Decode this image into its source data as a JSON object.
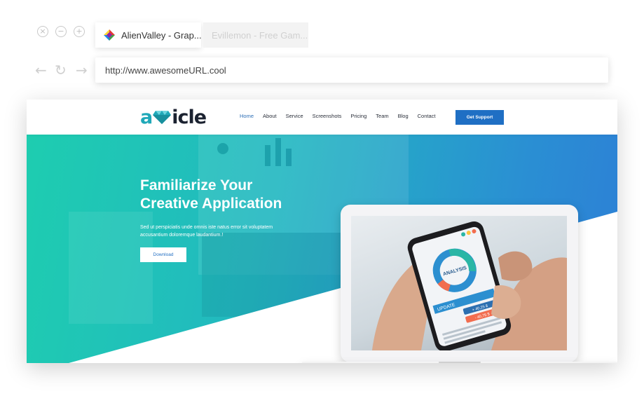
{
  "browser": {
    "tabs": [
      {
        "title": "AlienValley - Grap...",
        "active": true
      },
      {
        "title": "Evillemon - Free Gam...",
        "active": false
      }
    ],
    "url": "http://www.awesomeURL.cool"
  },
  "site": {
    "logo": {
      "a": "a",
      "rest": "icle"
    },
    "menu": [
      "Home",
      "About",
      "Service",
      "Screenshots",
      "Pricing",
      "Team",
      "Blog",
      "Contact"
    ],
    "active_menu": "Home",
    "cta_label": "Get Support",
    "hero": {
      "headline_line1": "Familiarize Your",
      "headline_line2": "Creative Application",
      "subtext_line1": "Sed ut perspiciatis unde omnis iste natus error sit voluptatem",
      "subtext_line2": "accusantium doloremque laudantium.!",
      "button_label": "Download"
    },
    "phone": {
      "donut_label": "ANALYSIS",
      "update_label": "UPDATE",
      "stat1": "+ 40,25 $",
      "stat2": "- 40,75 $"
    }
  },
  "colors": {
    "accent": "#1f6fc4",
    "hero_start": "#1ecdb0",
    "hero_end": "#2d7fd6"
  }
}
